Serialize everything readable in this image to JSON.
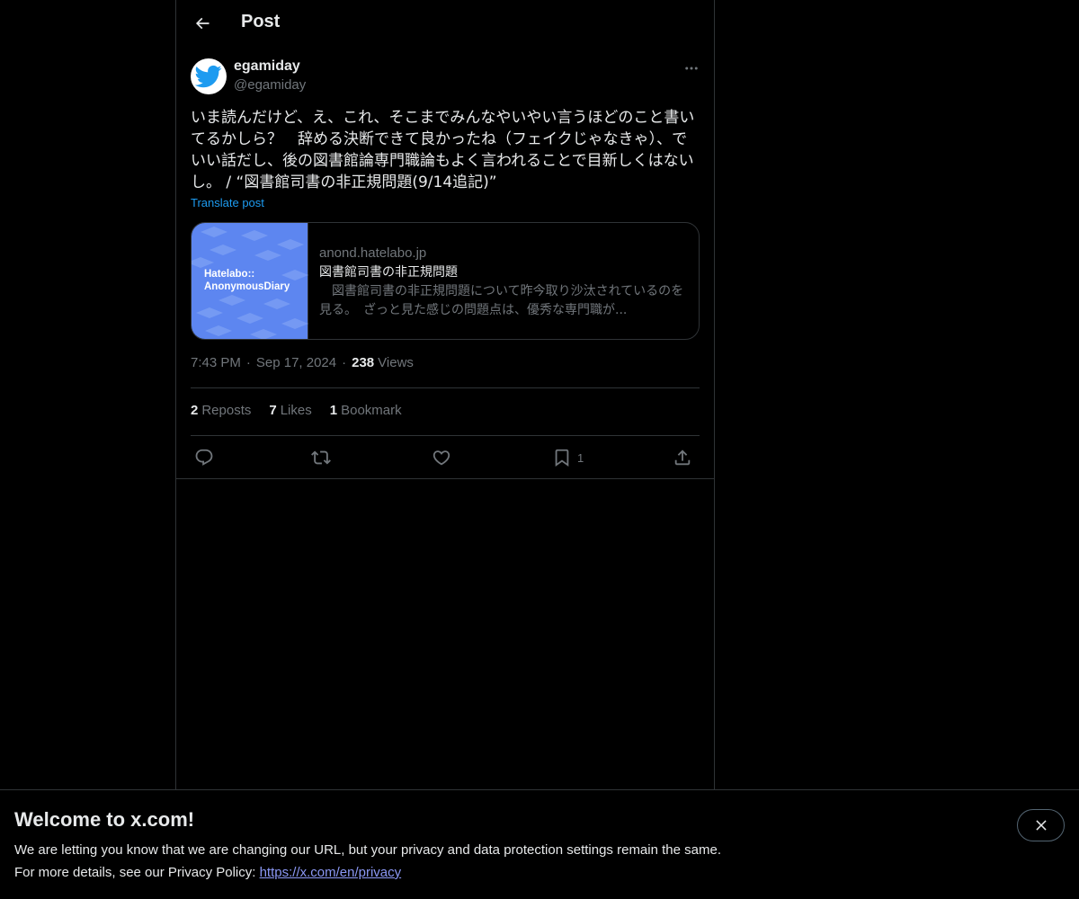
{
  "header": {
    "title": "Post"
  },
  "author": {
    "display_name": "egamiday",
    "handle": "@egamiday"
  },
  "post": {
    "text": "いま読んだけど、え、これ、そこまでみんなやいやい言うほどのこと書いてるかしら？　辞める決断できて良かったね（フェイクじゃなきゃ）、でいい話だし、後の図書館論専門職論もよく言われることで目新しくはないし。 / “図書館司書の非正規問題(9/14追記)”",
    "translate_label": "Translate post"
  },
  "card": {
    "thumbnail_text_line1": "Hatelabo::",
    "thumbnail_text_line2": "AnonymousDiary",
    "domain": "anond.hatelabo.jp",
    "title": "図書館司書の非正規問題",
    "description": "　図書館司書の非正規問題について昨今取り沙汰されているのを見る。　ざっと見た感じの問題点は、優秀な専門職が..."
  },
  "meta": {
    "time": "7:43 PM",
    "separator": "·",
    "date": "Sep 17, 2024",
    "views_count": "238",
    "views_label": "Views"
  },
  "stats": {
    "reposts_count": "2",
    "reposts_label": "Reposts",
    "likes_count": "7",
    "likes_label": "Likes",
    "bookmarks_count": "1",
    "bookmarks_label": "Bookmark"
  },
  "actions": {
    "bookmark_count": "1",
    "icons": [
      "reply-icon",
      "repost-icon",
      "like-icon",
      "bookmark-icon",
      "share-icon"
    ]
  },
  "banner": {
    "title": "Welcome to x.com!",
    "line1": "We are letting you know that we are changing our URL, but your privacy and data protection settings remain the same.",
    "line2_prefix": "For more details, see our Privacy Policy: ",
    "link": "https://x.com/en/privacy"
  },
  "colors": {
    "background": "#000000",
    "text": "#e7e9ea",
    "muted": "#71767b",
    "accent": "#1d9bf0",
    "border": "#2f3336",
    "link": "#8b98f5",
    "card_thumb": "#5d86f0"
  }
}
